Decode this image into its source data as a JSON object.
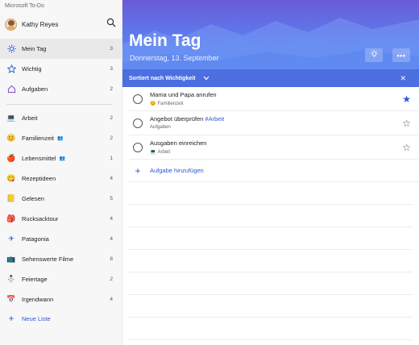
{
  "app": {
    "title": "Microsoft To-Do"
  },
  "profile": {
    "name": "Kathy Reyes"
  },
  "smart_lists": [
    {
      "label": "Mein Tag",
      "count": "3",
      "icon": "sun-icon",
      "active": true
    },
    {
      "label": "Wichtig",
      "count": "3",
      "icon": "star-icon"
    },
    {
      "label": "Aufgaben",
      "count": "2",
      "icon": "home-icon"
    }
  ],
  "lists": [
    {
      "label": "Arbeit",
      "count": "2",
      "icon": "laptop-icon"
    },
    {
      "label": "Familienzeit",
      "count": "2",
      "icon": "smiley-icon",
      "shared": true
    },
    {
      "label": "Lebensmittel",
      "count": "1",
      "icon": "apple-icon",
      "shared": true
    },
    {
      "label": "Rezeptideen",
      "count": "4",
      "icon": "yum-icon"
    },
    {
      "label": "Gelesen",
      "count": "5",
      "icon": "book-icon"
    },
    {
      "label": "Rucksacktour",
      "count": "4",
      "icon": "backpack-icon"
    },
    {
      "label": "Patagonia",
      "count": "4",
      "icon": "plane-icon"
    },
    {
      "label": "Sehenswerte Filme",
      "count": "8",
      "icon": "tv-icon"
    },
    {
      "label": "Feiertage",
      "count": "2",
      "icon": "snowman-icon"
    },
    {
      "label": "Irgendwann",
      "count": "4",
      "icon": "calendar-icon"
    }
  ],
  "new_list_label": "Neue Liste",
  "header": {
    "title": "Mein Tag",
    "date": "Donnerstag, 13. September"
  },
  "sortbar": {
    "label": "Sortiert nach Wichtigkeit"
  },
  "tasks": [
    {
      "title": "Mama und Papa anrufen",
      "tag": "",
      "list": "Familienzeit",
      "list_icon": "smiley-icon",
      "starred": true
    },
    {
      "title": "Angebot überprüfen",
      "tag": "#Arbeit",
      "list": "Aufgaben",
      "list_icon": "",
      "starred": false
    },
    {
      "title": "Ausgaben einreichen",
      "tag": "",
      "list": "Arbeit",
      "list_icon": "laptop-icon",
      "starred": false
    }
  ],
  "add_task_label": "Aufgabe hinzufügen",
  "colors": {
    "accent": "#2b58d8",
    "sortbar": "#4b6fe0",
    "hero_top": "#6b5bd6",
    "hero_bottom": "#4d8ff5"
  }
}
